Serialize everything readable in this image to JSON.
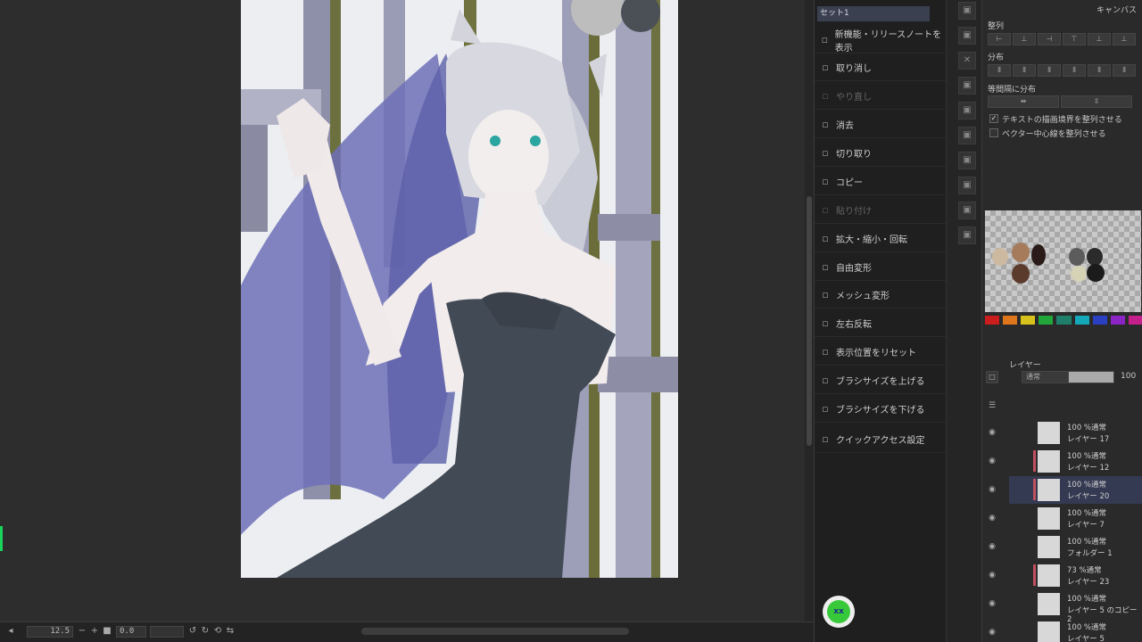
{
  "quick_access": {
    "tab_label": "セット1",
    "items": [
      {
        "label": "新機能・リリースノートを表示",
        "icon": "release-notes-icon",
        "enabled": true
      },
      {
        "label": "取り消し",
        "icon": "undo-icon",
        "enabled": true
      },
      {
        "label": "やり直し",
        "icon": "redo-icon",
        "enabled": false
      },
      {
        "label": "消去",
        "icon": "erase-icon",
        "enabled": true
      },
      {
        "label": "切り取り",
        "icon": "cut-icon",
        "enabled": true
      },
      {
        "label": "コピー",
        "icon": "copy-icon",
        "enabled": true
      },
      {
        "label": "貼り付け",
        "icon": "paste-icon",
        "enabled": false
      },
      {
        "label": "拡大・縮小・回転",
        "icon": "scale-rotate-icon",
        "enabled": true
      },
      {
        "label": "自由変形",
        "icon": "free-transform-icon",
        "enabled": true
      },
      {
        "label": "メッシュ変形",
        "icon": "mesh-transform-icon",
        "enabled": true
      },
      {
        "label": "左右反転",
        "icon": "flip-horizontal-icon",
        "enabled": true
      },
      {
        "label": "表示位置をリセット",
        "icon": "reset-view-icon",
        "enabled": true
      },
      {
        "label": "ブラシサイズを上げる",
        "icon": "brush-size-up-icon",
        "enabled": true
      },
      {
        "label": "ブラシサイズを下げる",
        "icon": "brush-size-down-icon",
        "enabled": true
      },
      {
        "label": "クイックアクセス設定",
        "icon": "quick-access-settings-icon",
        "enabled": true
      }
    ]
  },
  "align_panel": {
    "top_label": "キャンバス",
    "align_label": "整列",
    "distribute_label": "分布",
    "equal_spacing_label": "等間隔に分布",
    "option1": "テキストの描画境界を整列させる",
    "option1_checked": true,
    "option2": "ベクター中心線を整列させる",
    "option2_checked": false
  },
  "color_set": {
    "colors": [
      "#cc1d1d",
      "#e0761b",
      "#d7c21d",
      "#22a63a",
      "#1f7f6a",
      "#14a8b8",
      "#2a3fc2",
      "#8a24c4",
      "#c41f8a"
    ]
  },
  "layers_panel": {
    "tab_label": "レイヤー",
    "blend_mode": "通常",
    "opacity": "100",
    "layers": [
      {
        "line1": "100 %通常",
        "line2": "レイヤー 17",
        "selected": false,
        "marked": false
      },
      {
        "line1": "100 %通常",
        "line2": "レイヤー 12",
        "selected": false,
        "marked": true
      },
      {
        "line1": "100 %通常",
        "line2": "レイヤー 20",
        "selected": true,
        "marked": true
      },
      {
        "line1": "100 %通常",
        "line2": "レイヤー 7",
        "selected": false,
        "marked": false
      },
      {
        "line1": "100 %通常",
        "line2": "フォルダー 1",
        "selected": false,
        "marked": false
      },
      {
        "line1": "73 %通常",
        "line2": "レイヤー 23",
        "selected": false,
        "marked": true
      },
      {
        "line1": "100 %通常",
        "line2": "レイヤー 5 のコピー 2",
        "selected": false,
        "marked": false
      },
      {
        "line1": "100 %通常",
        "line2": "レイヤー 5",
        "selected": false,
        "marked": false
      }
    ]
  },
  "status_bar": {
    "zoom": "12.5",
    "angle": "0.0"
  }
}
